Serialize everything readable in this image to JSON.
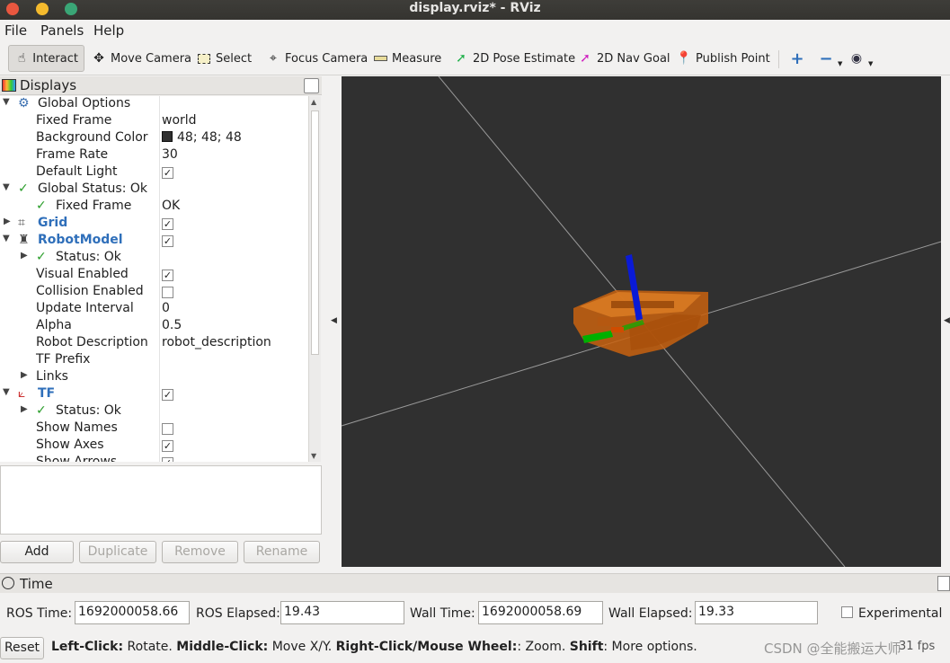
{
  "window": {
    "title": "display.rviz* - RViz"
  },
  "menu": {
    "file": "File",
    "panels": "Panels",
    "help": "Help"
  },
  "toolbar": {
    "interact": "Interact",
    "move_camera": "Move Camera",
    "select": "Select",
    "focus_camera": "Focus Camera",
    "measure": "Measure",
    "pose_estimate": "2D Pose Estimate",
    "nav_goal": "2D Nav Goal",
    "publish_point": "Publish Point"
  },
  "displays": {
    "title": "Displays",
    "rows": {
      "global_options": "Global Options",
      "fixed_frame_label": "Fixed Frame",
      "fixed_frame_value": "world",
      "bg_color_label": "Background Color",
      "bg_color_value": "48; 48; 48",
      "frame_rate_label": "Frame Rate",
      "frame_rate_value": "30",
      "default_light_label": "Default Light",
      "global_status": "Global Status: Ok",
      "gs_fixed_frame_label": "Fixed Frame",
      "gs_fixed_frame_value": "OK",
      "grid": "Grid",
      "robot_model": "RobotModel",
      "rm_status": "Status: Ok",
      "visual_enabled": "Visual Enabled",
      "collision_enabled": "Collision Enabled",
      "update_interval_label": "Update Interval",
      "update_interval_value": "0",
      "alpha_label": "Alpha",
      "alpha_value": "0.5",
      "robot_description_label": "Robot Description",
      "robot_description_value": "robot_description",
      "tf_prefix": "TF Prefix",
      "links": "Links",
      "tf": "TF",
      "tf_status": "Status: Ok",
      "show_names": "Show Names",
      "show_axes": "Show Axes",
      "show_arrows_partial": "Show Arrows"
    },
    "buttons": {
      "add": "Add",
      "duplicate": "Duplicate",
      "remove": "Remove",
      "rename": "Rename"
    }
  },
  "time": {
    "title": "Time",
    "ros_time_label": "ROS Time:",
    "ros_time_value": "1692000058.66",
    "ros_elapsed_label": "ROS Elapsed:",
    "ros_elapsed_value": "19.43",
    "wall_time_label": "Wall Time:",
    "wall_time_value": "1692000058.69",
    "wall_elapsed_label": "Wall Elapsed:",
    "wall_elapsed_value": "19.33",
    "experimental_label": "Experimental"
  },
  "status": {
    "reset": "Reset",
    "left_click": "Left-Click:",
    "left_click_desc": " Rotate. ",
    "middle_click": "Middle-Click:",
    "middle_click_desc": " Move X/Y. ",
    "right_click": "Right-Click/Mouse Wheel:",
    "right_click_desc": ": Zoom. ",
    "shift": "Shift",
    "shift_desc": ": More options.",
    "fps": "31 fps",
    "watermark": "CSDN @全能搬运大师"
  },
  "colors": {
    "viewport_bg": "#303030",
    "robot_body": "#c8620f",
    "axis_x": "#00b000",
    "axis_z": "#0a1ad6",
    "accent_blue": "#2f6fba"
  }
}
